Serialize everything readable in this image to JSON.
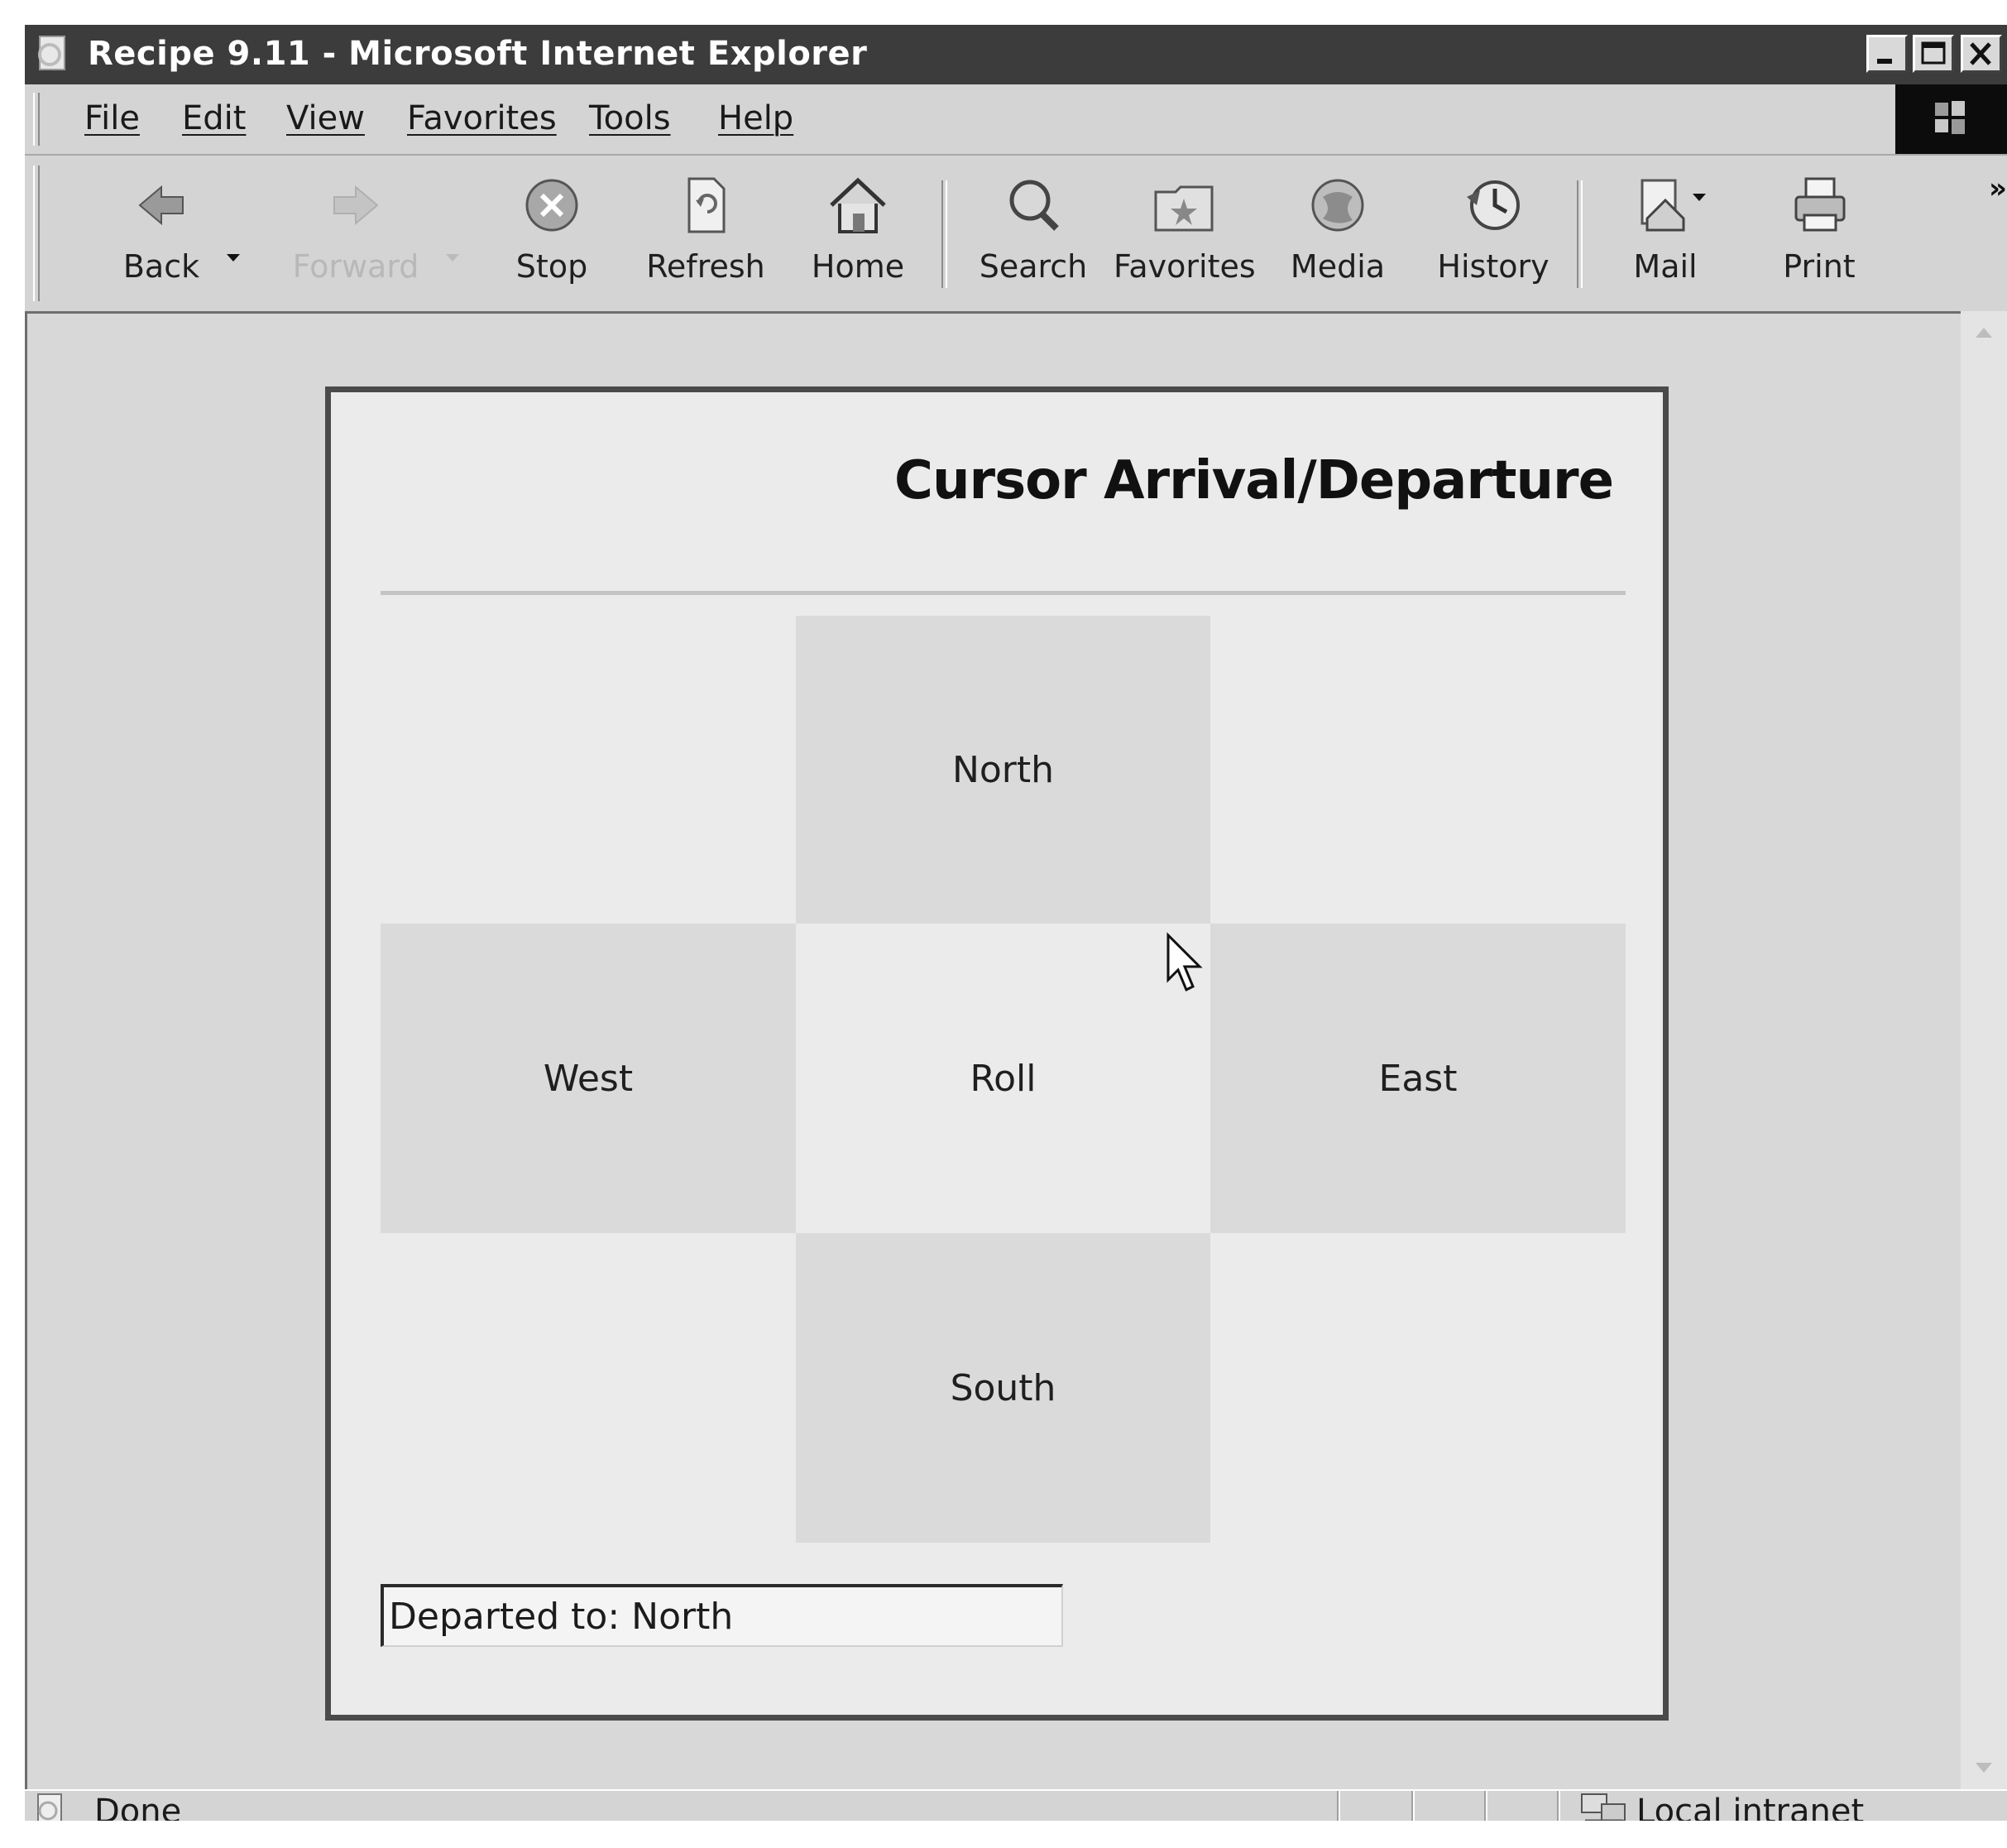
{
  "window": {
    "title": "Recipe 9.11 - Microsoft Internet Explorer",
    "controls": [
      "minimize",
      "maximize",
      "close"
    ]
  },
  "menu": {
    "items": [
      {
        "label": "File"
      },
      {
        "label": "Edit"
      },
      {
        "label": "View"
      },
      {
        "label": "Favorites"
      },
      {
        "label": "Tools"
      },
      {
        "label": "Help"
      }
    ]
  },
  "toolbar": {
    "buttons": [
      {
        "label": "Back",
        "icon": "back-arrow-icon",
        "enabled": true
      },
      {
        "label": "Forward",
        "icon": "forward-arrow-icon",
        "enabled": false
      },
      {
        "label": "Stop",
        "icon": "stop-icon",
        "enabled": true
      },
      {
        "label": "Refresh",
        "icon": "refresh-icon",
        "enabled": true
      },
      {
        "label": "Home",
        "icon": "home-icon",
        "enabled": true
      },
      {
        "label": "Search",
        "icon": "search-icon",
        "enabled": true
      },
      {
        "label": "Favorites",
        "icon": "favorites-folder-icon",
        "enabled": true
      },
      {
        "label": "Media",
        "icon": "media-icon",
        "enabled": true
      },
      {
        "label": "History",
        "icon": "history-icon",
        "enabled": true
      },
      {
        "label": "Mail",
        "icon": "mail-icon",
        "enabled": true
      },
      {
        "label": "Print",
        "icon": "print-icon",
        "enabled": true
      }
    ],
    "more": "»"
  },
  "page": {
    "heading": "Cursor Arrival/Departure",
    "zones": {
      "north": "North",
      "west": "West",
      "center": "Roll",
      "east": "East",
      "south": "South"
    },
    "status_field_value": "Departed to: North"
  },
  "statusbar": {
    "text": "Done",
    "zone": "Local intranet"
  },
  "colors": {
    "titlebar": "#3c3c3c",
    "chrome": "#d4d4d4",
    "panel": "#ebebeb",
    "zone": "#dadada"
  }
}
